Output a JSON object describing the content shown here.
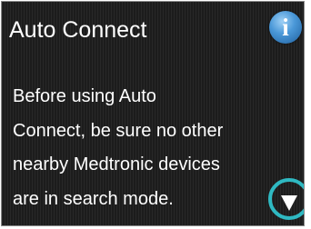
{
  "header": {
    "title": "Auto Connect",
    "info_icon": "info-icon",
    "info_glyph": "i"
  },
  "message": {
    "lines": [
      "Before using Auto",
      "Connect, be sure no other",
      "nearby Medtronic devices",
      "are in search mode."
    ]
  },
  "controls": {
    "scroll_down_icon": "down-arrow-icon"
  },
  "colors": {
    "background": "#1c1c1c",
    "text": "#ffffff",
    "info_button": "#4a98d8",
    "highlight_ring": "#2fb9c2"
  }
}
